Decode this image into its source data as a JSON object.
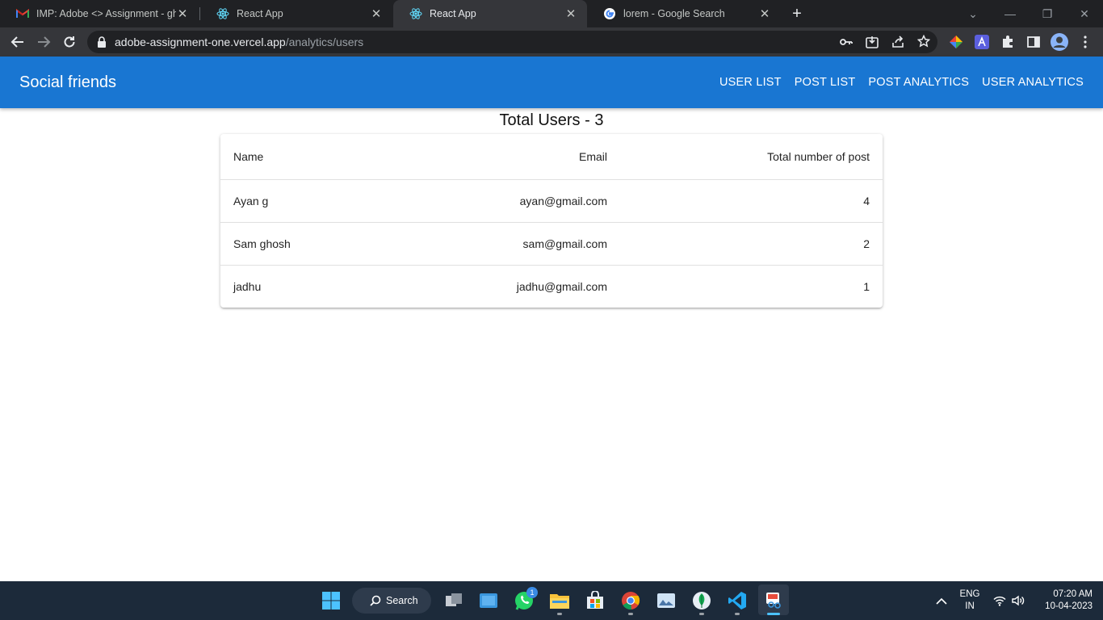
{
  "browser": {
    "tabs": [
      {
        "title": "IMP: Adobe <> Assignment - gh",
        "favicon": "gmail-icon"
      },
      {
        "title": "React App",
        "favicon": "react-icon"
      },
      {
        "title": "React App",
        "favicon": "react-icon",
        "active": true
      },
      {
        "title": "lorem - Google Search",
        "favicon": "google-icon"
      }
    ],
    "url_host": "adobe-assignment-one.vercel.app",
    "url_path": "/analytics/users"
  },
  "app": {
    "brand": "Social friends",
    "nav": [
      "USER LIST",
      "POST LIST",
      "POST ANALYTICS",
      "USER ANALYTICS"
    ],
    "heading": "Total Users - 3",
    "table": {
      "headers": [
        "Name",
        "Email",
        "Total number of post"
      ],
      "rows": [
        [
          "Ayan g",
          "ayan@gmail.com",
          "4"
        ],
        [
          "Sam ghosh",
          "sam@gmail.com",
          "2"
        ],
        [
          "jadhu",
          "jadhu@gmail.com",
          "1"
        ]
      ]
    },
    "colors": {
      "appbar": "#1976d2"
    }
  },
  "taskbar": {
    "search_label": "Search",
    "whatsapp_badge": "1",
    "lang": "ENG",
    "region": "IN",
    "time": "07:20 AM",
    "date": "10-04-2023"
  }
}
